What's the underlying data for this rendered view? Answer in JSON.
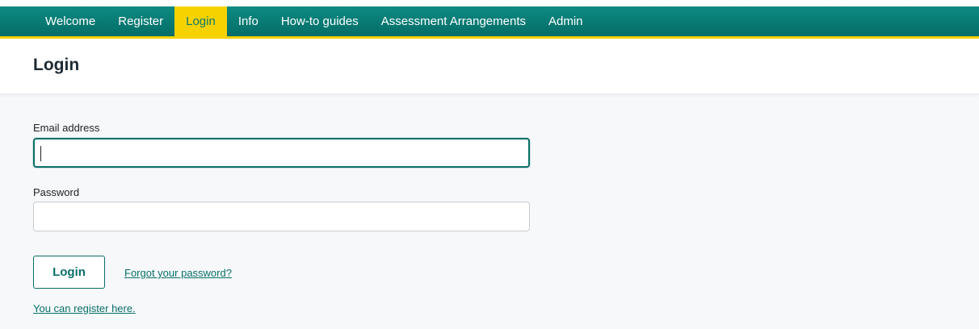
{
  "nav": {
    "items": [
      {
        "label": "Welcome"
      },
      {
        "label": "Register"
      },
      {
        "label": "Login"
      },
      {
        "label": "Info"
      },
      {
        "label": "How-to guides"
      },
      {
        "label": "Assessment Arrangements"
      },
      {
        "label": "Admin"
      }
    ],
    "active_index": 2
  },
  "page": {
    "title": "Login"
  },
  "form": {
    "email_label": "Email address",
    "email_value": "",
    "password_label": "Password",
    "password_value": "",
    "login_button_label": "Login",
    "forgot_password_link": "Forgot your password?",
    "register_link": "You can register here."
  },
  "colors": {
    "nav_background": "#077a73",
    "nav_active": "#f6d200",
    "accent": "#0a6f68"
  }
}
